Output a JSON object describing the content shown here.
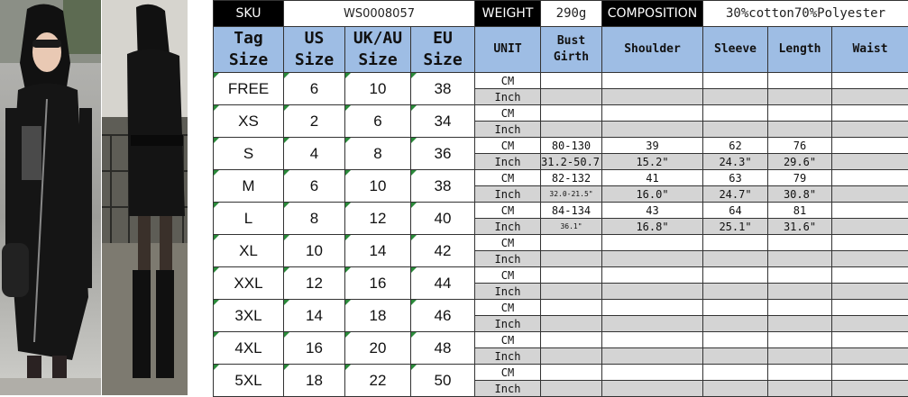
{
  "header": {
    "sku_label": "SKU",
    "sku_value": "WS0008057",
    "weight_label": "WEIGHT",
    "weight_value": "290g",
    "composition_label": "COMPOSITION",
    "composition_value": "30%cotton70%Polyester"
  },
  "columns": {
    "tag_size": [
      "Tag",
      "Size"
    ],
    "us_size": [
      "US",
      "Size"
    ],
    "ukau_size": [
      "UK/AU",
      "Size"
    ],
    "eu_size": [
      "EU",
      "Size"
    ],
    "unit": "UNIT",
    "bust_girth": [
      "Bust",
      "Girth"
    ],
    "shoulder": "Shoulder",
    "sleeve": "Sleeve",
    "length": "Length",
    "waist": "Waist"
  },
  "rows": [
    {
      "tag": "FREE",
      "us": "6",
      "uk": "10",
      "eu": "38",
      "cm": {
        "unit": "CM",
        "bust": "",
        "shoulder": "",
        "sleeve": "",
        "length": "",
        "waist": ""
      },
      "inch": {
        "unit": "Inch",
        "bust": "",
        "shoulder": "",
        "sleeve": "",
        "length": "",
        "waist": ""
      }
    },
    {
      "tag": "XS",
      "us": "2",
      "uk": "6",
      "eu": "34",
      "cm": {
        "unit": "CM",
        "bust": "",
        "shoulder": "",
        "sleeve": "",
        "length": "",
        "waist": ""
      },
      "inch": {
        "unit": "Inch",
        "bust": "",
        "shoulder": "",
        "sleeve": "",
        "length": "",
        "waist": ""
      }
    },
    {
      "tag": "S",
      "us": "4",
      "uk": "8",
      "eu": "36",
      "cm": {
        "unit": "CM",
        "bust": "80-130",
        "shoulder": "39",
        "sleeve": "62",
        "length": "76",
        "waist": ""
      },
      "inch": {
        "unit": "Inch",
        "bust": "31.2-50.7\"",
        "shoulder": "15.2\"",
        "sleeve": "24.3\"",
        "length": "29.6\"",
        "waist": ""
      }
    },
    {
      "tag": "M",
      "us": "6",
      "uk": "10",
      "eu": "38",
      "cm": {
        "unit": "CM",
        "bust": "82-132",
        "shoulder": "41",
        "sleeve": "63",
        "length": "79",
        "waist": ""
      },
      "inch": {
        "unit": "Inch",
        "bust": "32.0-21.5\"",
        "shoulder": "16.0\"",
        "sleeve": "24.7\"",
        "length": "30.8\"",
        "waist": ""
      }
    },
    {
      "tag": "L",
      "us": "8",
      "uk": "12",
      "eu": "40",
      "cm": {
        "unit": "CM",
        "bust": "84-134",
        "shoulder": "43",
        "sleeve": "64",
        "length": "81",
        "waist": ""
      },
      "inch": {
        "unit": "Inch",
        "bust": "36.1\"",
        "shoulder": "16.8\"",
        "sleeve": "25.1\"",
        "length": "31.6\"",
        "waist": ""
      }
    },
    {
      "tag": "XL",
      "us": "10",
      "uk": "14",
      "eu": "42",
      "cm": {
        "unit": "CM",
        "bust": "",
        "shoulder": "",
        "sleeve": "",
        "length": "",
        "waist": ""
      },
      "inch": {
        "unit": "Inch",
        "bust": "",
        "shoulder": "",
        "sleeve": "",
        "length": "",
        "waist": ""
      }
    },
    {
      "tag": "XXL",
      "us": "12",
      "uk": "16",
      "eu": "44",
      "cm": {
        "unit": "CM",
        "bust": "",
        "shoulder": "",
        "sleeve": "",
        "length": "",
        "waist": ""
      },
      "inch": {
        "unit": "Inch",
        "bust": "",
        "shoulder": "",
        "sleeve": "",
        "length": "",
        "waist": ""
      }
    },
    {
      "tag": "3XL",
      "us": "14",
      "uk": "18",
      "eu": "46",
      "cm": {
        "unit": "CM",
        "bust": "",
        "shoulder": "",
        "sleeve": "",
        "length": "",
        "waist": ""
      },
      "inch": {
        "unit": "Inch",
        "bust": "",
        "shoulder": "",
        "sleeve": "",
        "length": "",
        "waist": ""
      }
    },
    {
      "tag": "4XL",
      "us": "16",
      "uk": "20",
      "eu": "48",
      "cm": {
        "unit": "CM",
        "bust": "",
        "shoulder": "",
        "sleeve": "",
        "length": "",
        "waist": ""
      },
      "inch": {
        "unit": "Inch",
        "bust": "",
        "shoulder": "",
        "sleeve": "",
        "length": "",
        "waist": ""
      }
    },
    {
      "tag": "5XL",
      "us": "18",
      "uk": "22",
      "eu": "50",
      "cm": {
        "unit": "CM",
        "bust": "",
        "shoulder": "",
        "sleeve": "",
        "length": "",
        "waist": ""
      },
      "inch": {
        "unit": "Inch",
        "bust": "",
        "shoulder": "",
        "sleeve": "",
        "length": "",
        "waist": ""
      }
    }
  ]
}
